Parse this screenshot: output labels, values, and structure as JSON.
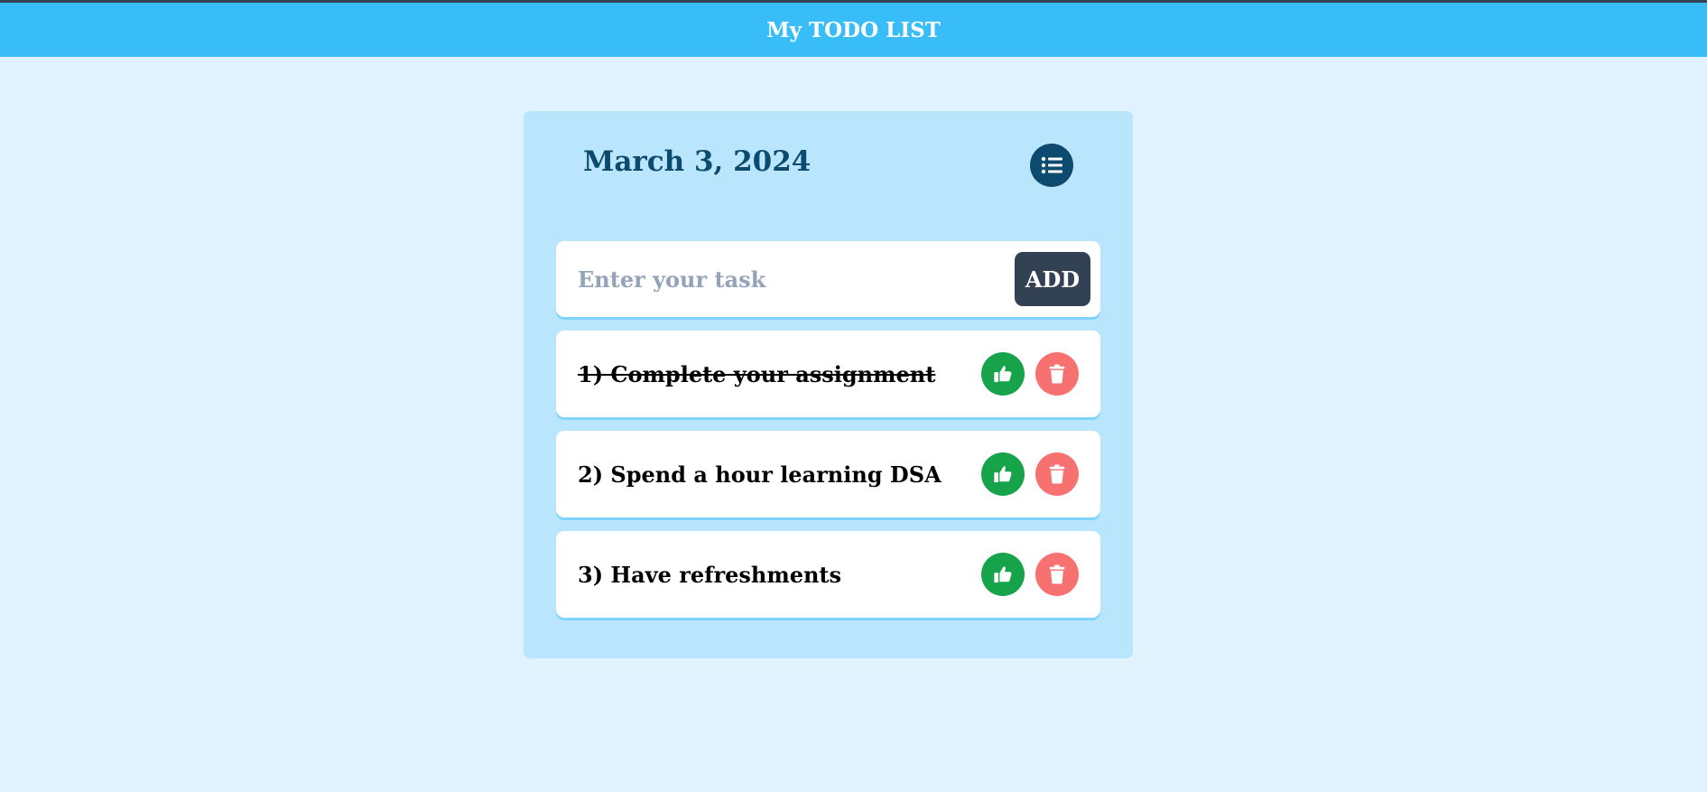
{
  "header": {
    "title": "My TODO LIST"
  },
  "card": {
    "date": "March 3, 2024",
    "toggle_icon": "list-icon"
  },
  "input": {
    "placeholder": "Enter your task",
    "value": "",
    "add_label": "ADD"
  },
  "tasks": [
    {
      "label": "1) Complete your assignment",
      "completed": true
    },
    {
      "label": "2) Spend a hour learning DSA",
      "completed": false
    },
    {
      "label": "3) Have refreshments",
      "completed": false
    }
  ],
  "icons": {
    "complete": "thumbs-up-icon",
    "delete": "trash-icon"
  },
  "colors": {
    "page_bg": "#e0f2fe",
    "header_bg": "#38bdf8",
    "card_bg": "#bae6fd",
    "date_text": "#0c4a6e",
    "add_button": "#334155",
    "complete_button": "#16a34a",
    "delete_button": "#f87171"
  }
}
